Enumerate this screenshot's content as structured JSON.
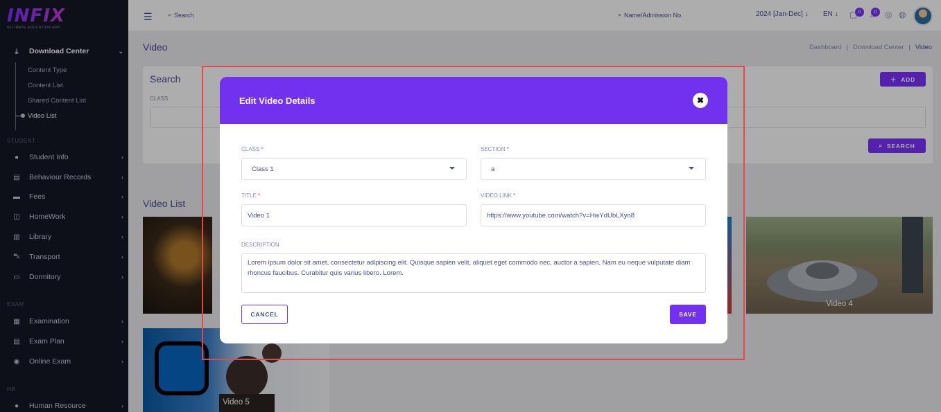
{
  "logo": {
    "name": "INFIX",
    "tagline": "ULTIMATE EDUCATION ERP"
  },
  "sidebar": {
    "download_center": {
      "label": "Download Center",
      "children": [
        "Content Type",
        "Content List",
        "Shared Content List",
        "Video List"
      ],
      "active_child": "Video List"
    },
    "section_student": "STUDENT",
    "student_items": [
      "Student Info",
      "Behaviour Records",
      "Fees",
      "HomeWork",
      "Library",
      "Transport",
      "Dormitory"
    ],
    "section_exam": "EXAM",
    "exam_items": [
      "Examination",
      "Exam Plan",
      "Online Exam"
    ],
    "section_hr": "HR",
    "hr_items": [
      "Human Resource"
    ]
  },
  "topbar": {
    "search_placeholder": "Search",
    "admission_search": "Name/Admission No.",
    "session": "2024 [Jan-Dec]",
    "language": "EN",
    "chat_count": "0",
    "notification_count": "0"
  },
  "page": {
    "title": "Video",
    "breadcrumb": [
      "Dashboard",
      "Download Center",
      "Video"
    ]
  },
  "search_panel": {
    "title": "Search",
    "class_label": "CLASS",
    "add_label": "ADD",
    "search_label": "SEARCH"
  },
  "video_list": {
    "title": "Video List",
    "items": [
      "Video 4",
      "Video 5"
    ]
  },
  "modal": {
    "title": "Edit Video Details",
    "class_label": "CLASS",
    "class_value": "Class 1",
    "section_label": "SECTION",
    "section_value": "a",
    "title_label": "TITLE",
    "title_value": "Video 1",
    "link_label": "VIDEO LINK",
    "link_value": "https://www.youtube.com/watch?v=HwYdUbLXyn8",
    "description_label": "DESCRIPTION",
    "description_value": "Lorem ipsum dolor sit amet, consectetur adipiscing elit. Quisque sapien velit, aliquet eget commodo nec, auctor a sapien. Nam eu neque vulputate diam rhoncus faucibus. Curabitur quis varius libero. Lorem.",
    "required_mark": "*",
    "cancel_label": "CANCEL",
    "save_label": "SAVE"
  },
  "colors": {
    "accent": "#7131ef",
    "sidebar_bg": "#141826",
    "text": "#415094",
    "highlight": "#e54848"
  }
}
